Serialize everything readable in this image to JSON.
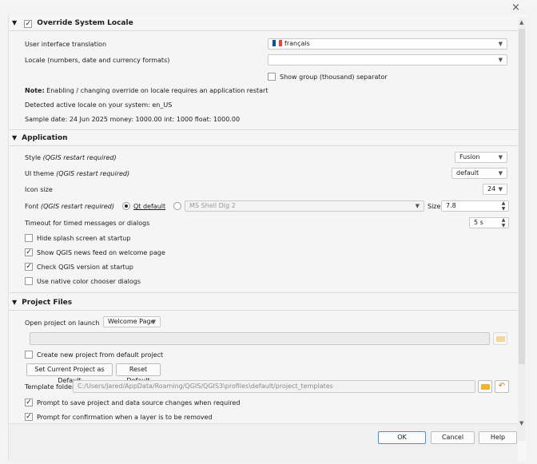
{
  "window": {
    "close_glyph": "×"
  },
  "locale": {
    "header": "Override System Locale",
    "ui_translation_label": "User interface translation",
    "ui_translation_value": "français",
    "locale_label": "Locale (numbers, date and currency formats)",
    "locale_value": "",
    "group_sep_label": "Show group (thousand) separator",
    "note_bold": "Note:",
    "note_text": " Enabling / changing override on locale requires an application restart",
    "detected": "Detected active locale on your system: en_US",
    "sample": "Sample date: 24 Jun 2025 money: 1000.00 int: 1000 float: 1000.00"
  },
  "application": {
    "header": "Application",
    "style_label": "Style",
    "restart_note": "(QGIS restart required)",
    "style_value": "Fusion",
    "theme_label": "UI theme",
    "theme_value": "default",
    "icon_size_label": "Icon size",
    "icon_size_value": "24",
    "font_label": "Font",
    "qt_default_label": "Qt default",
    "font_value": "MS Shell Dlg 2",
    "size_label": "Size",
    "size_value": "7.8",
    "timeout_label": "Timeout for timed messages or dialogs",
    "timeout_value": "5 s",
    "checkboxes": [
      {
        "label": "Hide splash screen at startup",
        "checked": false
      },
      {
        "label": "Show QGIS news feed on welcome page",
        "checked": true
      },
      {
        "label": "Check QGIS version at startup",
        "checked": true
      },
      {
        "label": "Use native color chooser dialogs",
        "checked": false
      }
    ]
  },
  "project": {
    "header": "Project Files",
    "open_label": "Open project on launch",
    "open_value": "Welcome Page",
    "create_default_label": "Create new project from default project",
    "set_current_button": "Set Current Project as Default",
    "reset_button": "Reset Default",
    "template_label": "Template folder",
    "template_value": "C:/Users/Jared/AppData/Roaming/QGIS/QGIS3\\profiles\\default/project_templates",
    "prompt_save_label": "Prompt to save project and data source changes when required",
    "prompt_confirm_label": "Prompt for confirmation when a layer is to be removed"
  },
  "footer": {
    "ok": "OK",
    "cancel": "Cancel",
    "help": "Help"
  },
  "colors": {
    "folder": "#f0b429",
    "check_mark": "#222222"
  }
}
